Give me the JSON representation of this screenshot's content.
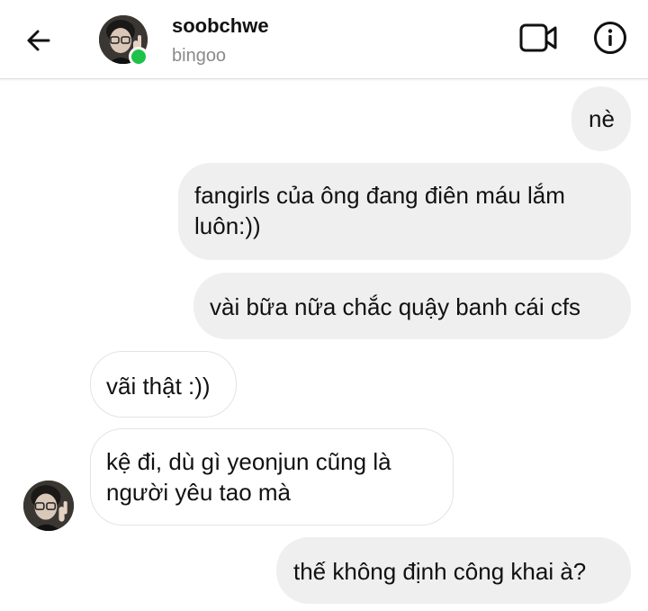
{
  "header": {
    "username": "soobchwe",
    "subtitle": "bingoo",
    "icons": [
      "back-arrow-icon",
      "video-camera-icon",
      "info-icon"
    ],
    "online_color": "#1ec14a"
  },
  "messages": [
    {
      "side": "out",
      "lines": [
        "nè"
      ]
    },
    {
      "side": "out",
      "lines": [
        "fangirls của ông đang điên máu lắm",
        "luôn:))"
      ]
    },
    {
      "side": "out",
      "lines": [
        "vài bữa nữa chắc quậy banh cái cfs"
      ]
    },
    {
      "side": "in",
      "lines": [
        "vãi thật :))"
      ]
    },
    {
      "side": "in",
      "lines": [
        "kệ đi, dù gì yeonjun cũng là",
        "người yêu tao mà"
      ]
    },
    {
      "side": "out",
      "lines": [
        "thế không định công khai à?"
      ]
    }
  ],
  "colors": {
    "outgoing_bubble": "#efefef",
    "incoming_border": "#e3e3e3"
  }
}
